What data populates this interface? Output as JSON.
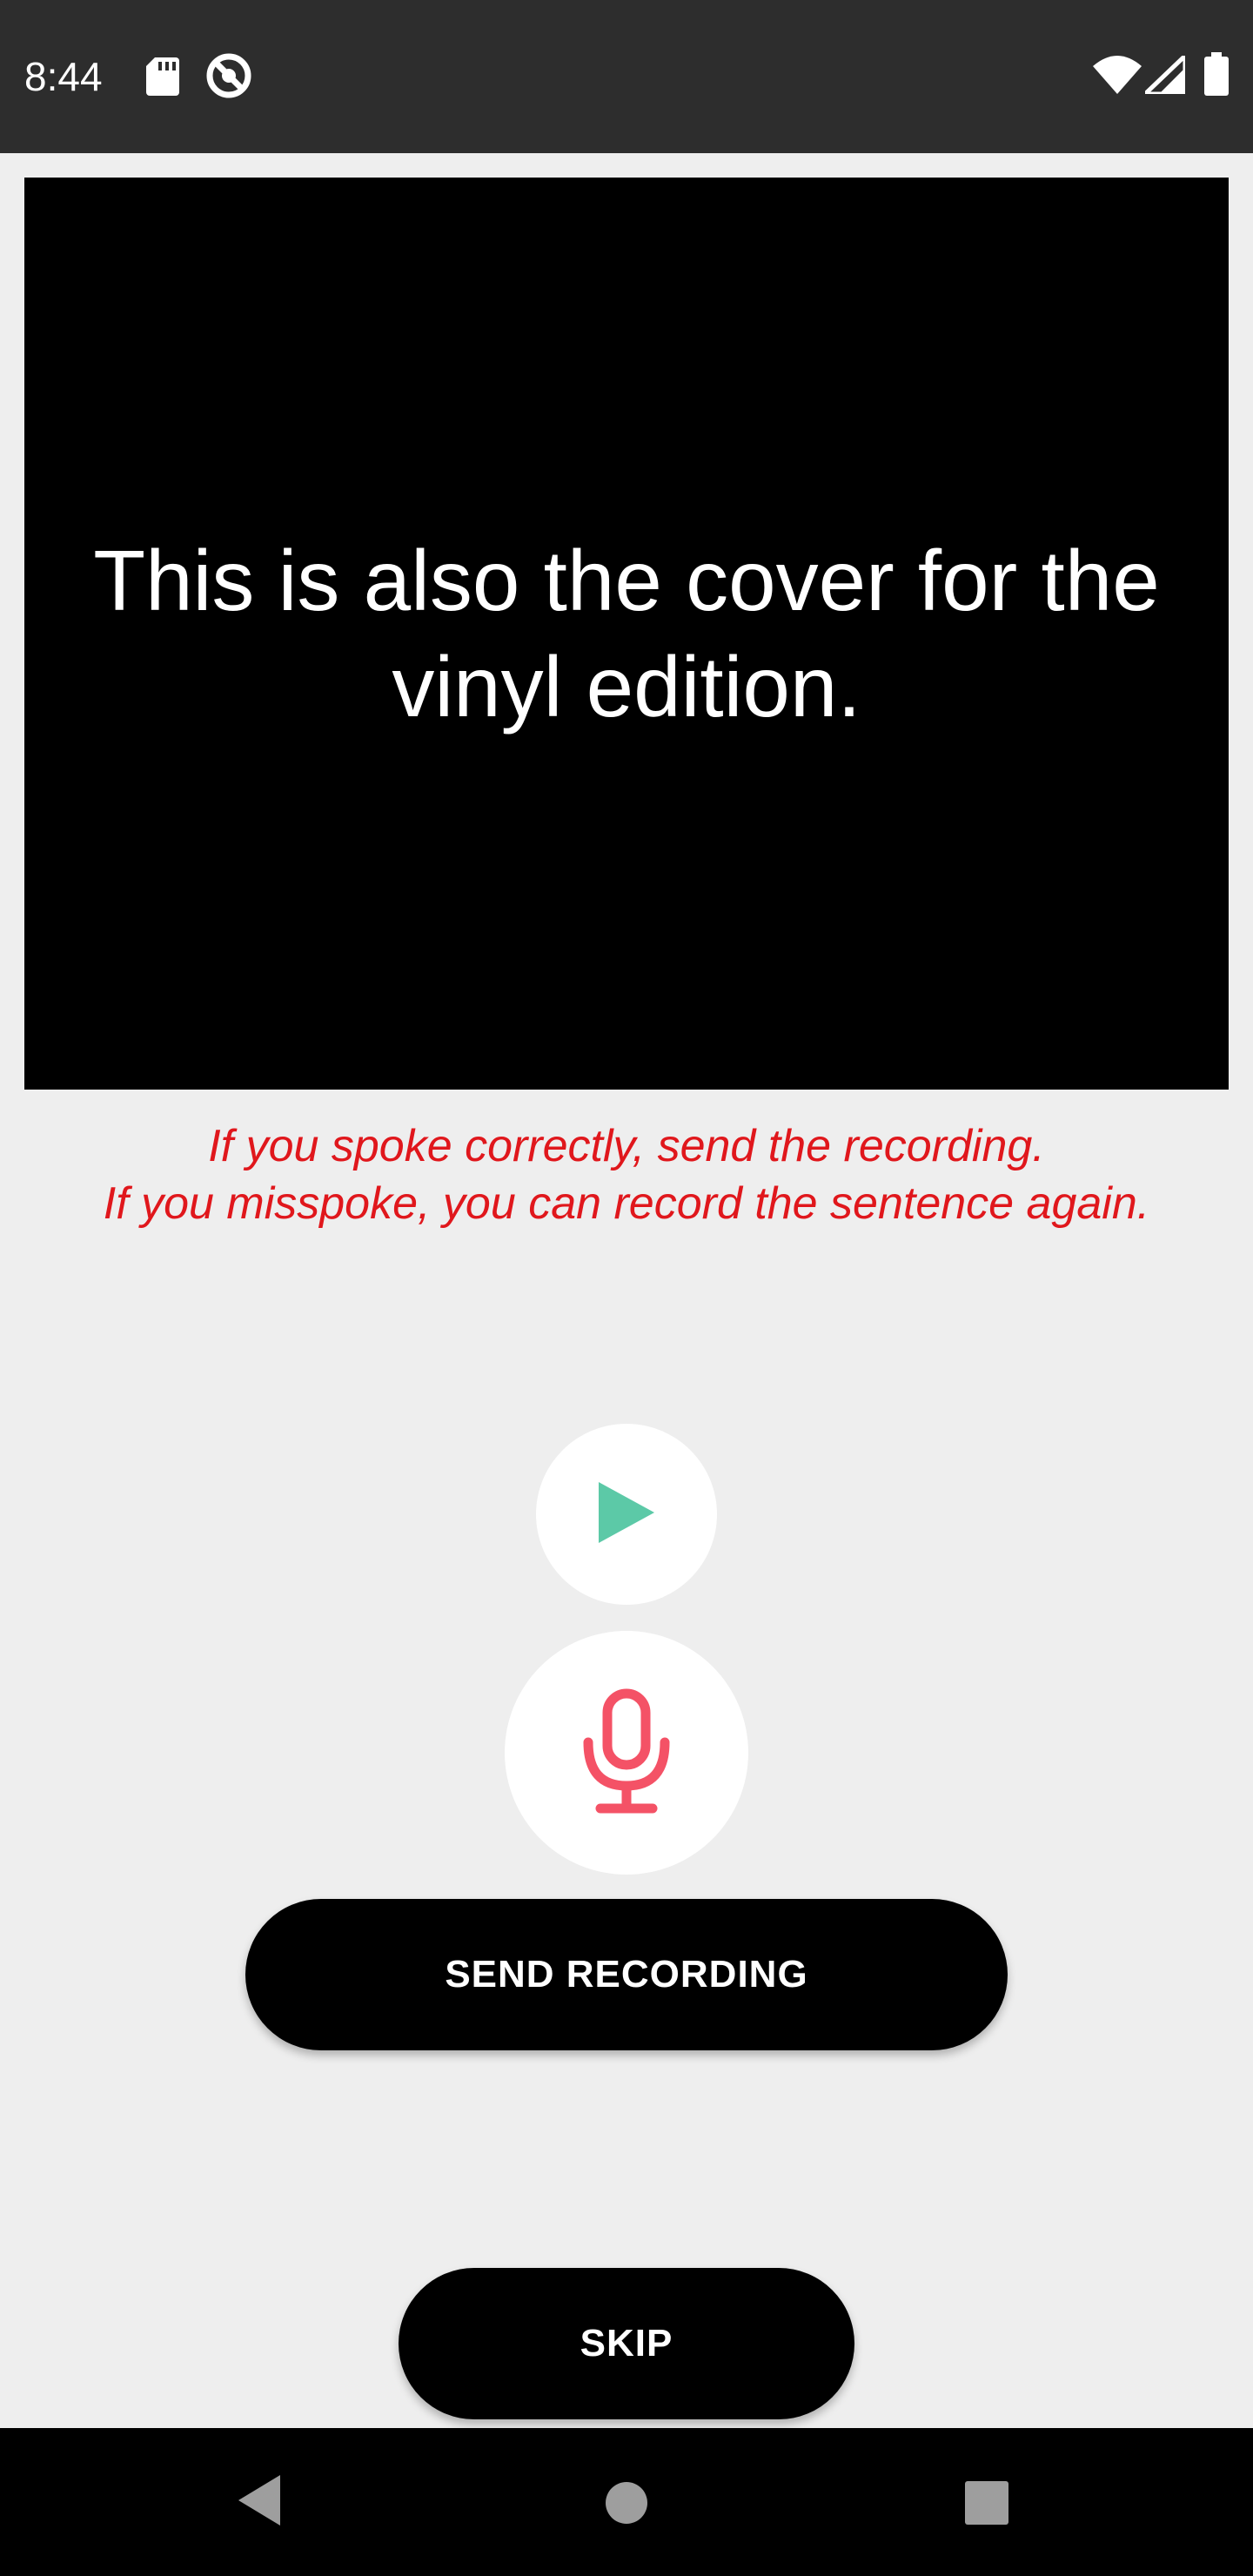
{
  "status_bar": {
    "time": "8:44",
    "icons": [
      "sd-card-icon",
      "do-not-disturb-icon",
      "wifi-icon",
      "cell-signal-icon",
      "battery-icon"
    ]
  },
  "sentence": {
    "text": "This is also the cover for the vinyl edition."
  },
  "instructions": {
    "line1": "If you spoke correctly, send the recording.",
    "line2": "If you misspoke, you can record the sentence again."
  },
  "controls": {
    "play_icon": "play-icon",
    "mic_icon": "microphone-icon",
    "send_label": "SEND RECORDING",
    "skip_label": "SKIP"
  },
  "nav_bar": {
    "icons": [
      "back-icon",
      "home-icon",
      "recents-icon"
    ]
  },
  "colors": {
    "status_bar": "#2d2d2d",
    "background": "#eeeeee",
    "instruction_text": "#e0171c",
    "play_accent": "#5cc9a7",
    "mic_accent": "#f45266",
    "button": "#000000"
  }
}
